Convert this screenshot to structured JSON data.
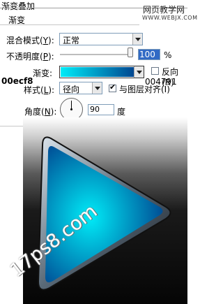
{
  "header": {
    "section_title": "渐变叠加",
    "sub_title": "渐变",
    "watermark_cn": "网页教学网",
    "watermark_url": "WWW.WEBJX.COM"
  },
  "blend_mode": {
    "label": "混合模式(",
    "key": "Y",
    "label_end": "):",
    "value": "正常"
  },
  "opacity": {
    "label": "不透明度(",
    "key": "P",
    "label_end": "):",
    "value": "100",
    "unit": "%",
    "level_percent": 100
  },
  "gradient": {
    "label": "渐变:",
    "start_color_label": "00ecf8",
    "end_color_label": "004791",
    "start_color": "#00ecf8",
    "end_color": "#004791",
    "reverse_label": "反向(R)",
    "reverse_checked": false
  },
  "style": {
    "label": "样式(",
    "key": "L",
    "label_end": "):",
    "value": "径向",
    "align_label": "与图层对齐(I)",
    "align_checked": true
  },
  "angle": {
    "label": "角度(",
    "key": "N",
    "label_end": "):",
    "value": "90",
    "unit": "度"
  },
  "preview": {
    "watermark": "17ps8.com"
  },
  "icons": {
    "dropdown": "chevron-down-icon",
    "check": "checkmark-icon"
  }
}
